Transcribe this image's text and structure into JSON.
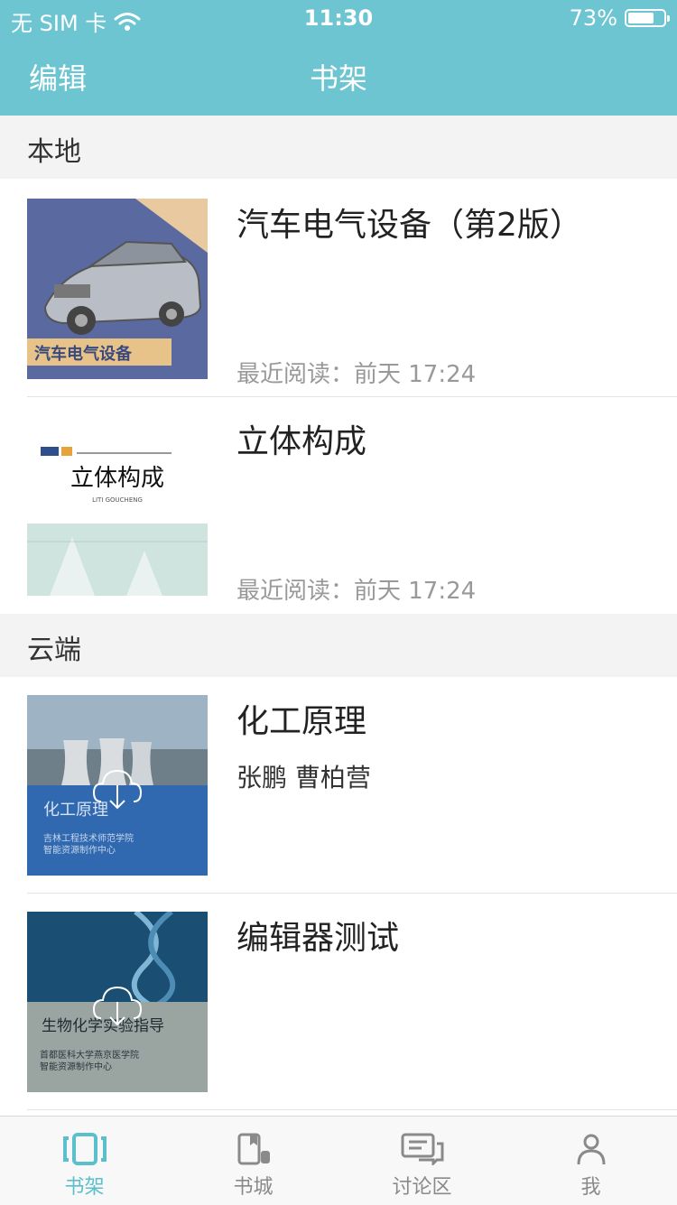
{
  "status_bar": {
    "carrier": "无 SIM 卡",
    "time": "11:30",
    "battery": "73%",
    "battery_level": 0.73
  },
  "nav": {
    "edit_label": "编辑",
    "title": "书架"
  },
  "sections": {
    "local": "本地",
    "cloud": "云端"
  },
  "books": [
    {
      "title": "汽车电气设备（第2版）",
      "meta": "最近阅读：前天  17:24",
      "cover_text": "汽车电气设备"
    },
    {
      "title": "立体构成",
      "meta": "最近阅读：前天  17:24",
      "cover_text": "立体构成",
      "cover_sub": "LITI  GOUCHENG"
    },
    {
      "title": "化工原理",
      "author": "张鹏 曹柏营",
      "cover_text": "化工原理",
      "cover_sub1": "吉林工程技术师范学院",
      "cover_sub2": "智能资源制作中心"
    },
    {
      "title": "编辑器测试",
      "cover_text": "生物化学实验指导",
      "cover_sub1": "首都医科大学燕京医学院",
      "cover_sub2": "智能资源制作中心"
    }
  ],
  "tabs": [
    {
      "label": "书架",
      "icon": "bookshelf-icon",
      "active": true
    },
    {
      "label": "书城",
      "icon": "bookstore-icon",
      "active": false
    },
    {
      "label": "讨论区",
      "icon": "discussion-icon",
      "active": false
    },
    {
      "label": "我",
      "icon": "profile-icon",
      "active": false
    }
  ],
  "colors": {
    "accent": "#6cc5d1",
    "active_tab": "#5bbfcc"
  }
}
